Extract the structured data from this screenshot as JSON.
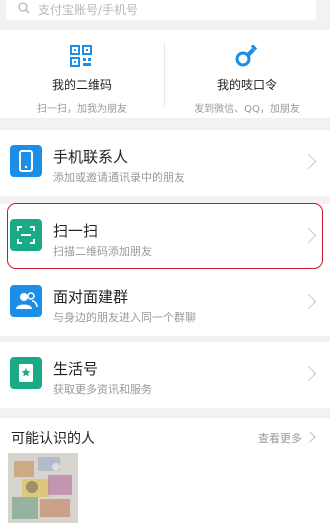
{
  "search": {
    "placeholder": "支付宝账号/手机号"
  },
  "top_cards": [
    {
      "title": "我的二维码",
      "subtitle": "扫一扫，加我为朋友",
      "icon": "qr-code-icon"
    },
    {
      "title": "我的吱口令",
      "subtitle": "发到微信、QQ，加朋友",
      "icon": "whistle-icon"
    }
  ],
  "rows": [
    {
      "name": "手机联系人",
      "desc": "添加或邀请通讯录中的朋友",
      "icon": "phone-icon",
      "color": "#1b8fe8"
    },
    {
      "name": "扫一扫",
      "desc": "扫描二维码添加朋友",
      "icon": "scan-icon",
      "color": "#1aab86"
    },
    {
      "name": "面对面建群",
      "desc": "与身边的朋友进入同一个群聊",
      "icon": "group-icon",
      "color": "#1b8fe8"
    },
    {
      "name": "生活号",
      "desc": "获取更多资讯和服务",
      "icon": "life-account-icon",
      "color": "#1aab86"
    }
  ],
  "people": {
    "title": "可能认识的人",
    "more": "查看更多"
  },
  "colors": {
    "highlight": "#c91a2a",
    "accent_blue": "#1b8fe8",
    "accent_green": "#1aab86"
  }
}
